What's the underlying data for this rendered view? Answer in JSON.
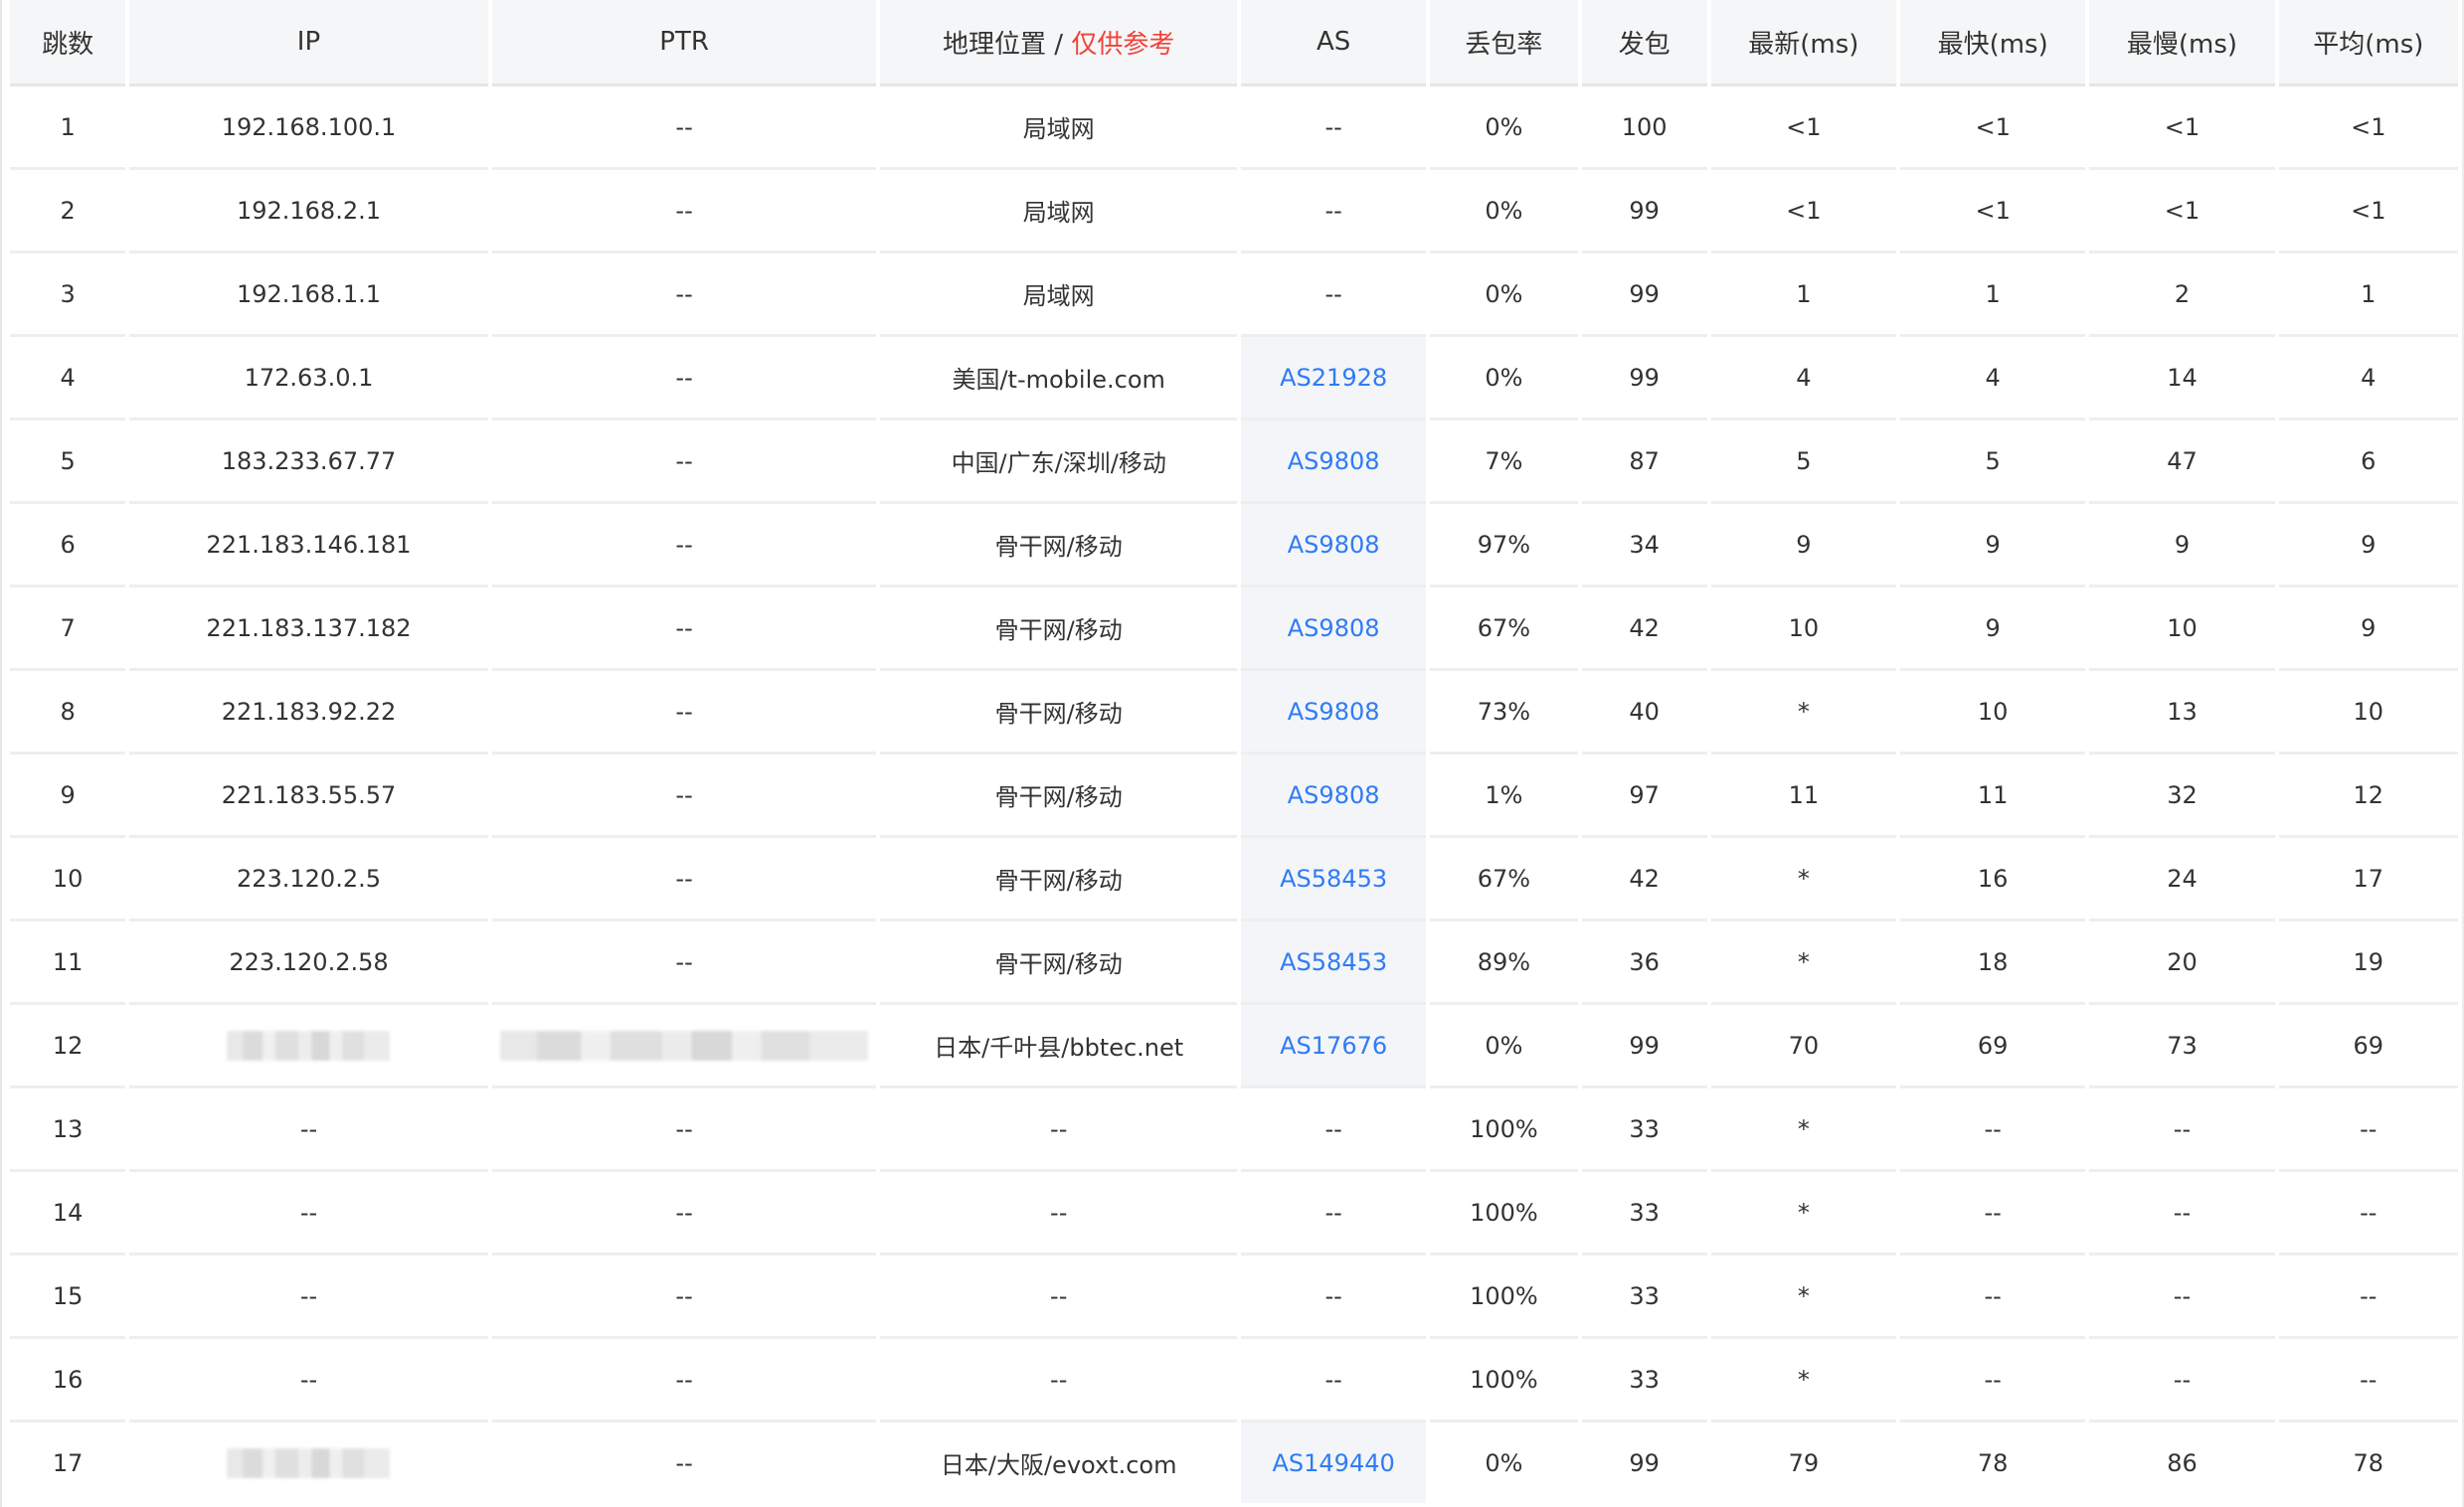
{
  "headers": {
    "hop": "跳数",
    "ip": "IP",
    "ptr": "PTR",
    "geo": "地理位置",
    "geo_sep": " / ",
    "geo_note": "仅供参考",
    "as": "AS",
    "loss": "丢包率",
    "sent": "发包",
    "last": "最新(ms)",
    "best": "最快(ms)",
    "worst": "最慢(ms)",
    "avg": "平均(ms)"
  },
  "colors": {
    "link": "#2f7bf5",
    "note": "#f0433a",
    "header_bg": "#f5f6f7",
    "as_cell_bg": "#f3f5f8"
  },
  "rows": [
    {
      "hop": "1",
      "ip": "192.168.100.1",
      "ip_redacted": false,
      "ptr": "--",
      "ptr_redacted": false,
      "geo": "局域网",
      "as": "--",
      "as_link": false,
      "loss": "0%",
      "sent": "100",
      "last": "<1",
      "best": "<1",
      "worst": "<1",
      "avg": "<1"
    },
    {
      "hop": "2",
      "ip": "192.168.2.1",
      "ip_redacted": false,
      "ptr": "--",
      "ptr_redacted": false,
      "geo": "局域网",
      "as": "--",
      "as_link": false,
      "loss": "0%",
      "sent": "99",
      "last": "<1",
      "best": "<1",
      "worst": "<1",
      "avg": "<1"
    },
    {
      "hop": "3",
      "ip": "192.168.1.1",
      "ip_redacted": false,
      "ptr": "--",
      "ptr_redacted": false,
      "geo": "局域网",
      "as": "--",
      "as_link": false,
      "loss": "0%",
      "sent": "99",
      "last": "1",
      "best": "1",
      "worst": "2",
      "avg": "1"
    },
    {
      "hop": "4",
      "ip": "172.63.0.1",
      "ip_redacted": false,
      "ptr": "--",
      "ptr_redacted": false,
      "geo": "美国/t-mobile.com",
      "as": "AS21928",
      "as_link": true,
      "loss": "0%",
      "sent": "99",
      "last": "4",
      "best": "4",
      "worst": "14",
      "avg": "4"
    },
    {
      "hop": "5",
      "ip": "183.233.67.77",
      "ip_redacted": false,
      "ptr": "--",
      "ptr_redacted": false,
      "geo": "中国/广东/深圳/移动",
      "as": "AS9808",
      "as_link": true,
      "loss": "7%",
      "sent": "87",
      "last": "5",
      "best": "5",
      "worst": "47",
      "avg": "6"
    },
    {
      "hop": "6",
      "ip": "221.183.146.181",
      "ip_redacted": false,
      "ptr": "--",
      "ptr_redacted": false,
      "geo": "骨干网/移动",
      "as": "AS9808",
      "as_link": true,
      "loss": "97%",
      "sent": "34",
      "last": "9",
      "best": "9",
      "worst": "9",
      "avg": "9"
    },
    {
      "hop": "7",
      "ip": "221.183.137.182",
      "ip_redacted": false,
      "ptr": "--",
      "ptr_redacted": false,
      "geo": "骨干网/移动",
      "as": "AS9808",
      "as_link": true,
      "loss": "67%",
      "sent": "42",
      "last": "10",
      "best": "9",
      "worst": "10",
      "avg": "9"
    },
    {
      "hop": "8",
      "ip": "221.183.92.22",
      "ip_redacted": false,
      "ptr": "--",
      "ptr_redacted": false,
      "geo": "骨干网/移动",
      "as": "AS9808",
      "as_link": true,
      "loss": "73%",
      "sent": "40",
      "last": "*",
      "best": "10",
      "worst": "13",
      "avg": "10"
    },
    {
      "hop": "9",
      "ip": "221.183.55.57",
      "ip_redacted": false,
      "ptr": "--",
      "ptr_redacted": false,
      "geo": "骨干网/移动",
      "as": "AS9808",
      "as_link": true,
      "loss": "1%",
      "sent": "97",
      "last": "11",
      "best": "11",
      "worst": "32",
      "avg": "12"
    },
    {
      "hop": "10",
      "ip": "223.120.2.5",
      "ip_redacted": false,
      "ptr": "--",
      "ptr_redacted": false,
      "geo": "骨干网/移动",
      "as": "AS58453",
      "as_link": true,
      "loss": "67%",
      "sent": "42",
      "last": "*",
      "best": "16",
      "worst": "24",
      "avg": "17"
    },
    {
      "hop": "11",
      "ip": "223.120.2.58",
      "ip_redacted": false,
      "ptr": "--",
      "ptr_redacted": false,
      "geo": "骨干网/移动",
      "as": "AS58453",
      "as_link": true,
      "loss": "89%",
      "sent": "36",
      "last": "*",
      "best": "18",
      "worst": "20",
      "avg": "19"
    },
    {
      "hop": "12",
      "ip": "",
      "ip_redacted": true,
      "ptr": "",
      "ptr_redacted": true,
      "geo": "日本/千叶县/bbtec.net",
      "as": "AS17676",
      "as_link": true,
      "loss": "0%",
      "sent": "99",
      "last": "70",
      "best": "69",
      "worst": "73",
      "avg": "69"
    },
    {
      "hop": "13",
      "ip": "--",
      "ip_redacted": false,
      "ptr": "--",
      "ptr_redacted": false,
      "geo": "--",
      "as": "--",
      "as_link": false,
      "loss": "100%",
      "sent": "33",
      "last": "*",
      "best": "--",
      "worst": "--",
      "avg": "--"
    },
    {
      "hop": "14",
      "ip": "--",
      "ip_redacted": false,
      "ptr": "--",
      "ptr_redacted": false,
      "geo": "--",
      "as": "--",
      "as_link": false,
      "loss": "100%",
      "sent": "33",
      "last": "*",
      "best": "--",
      "worst": "--",
      "avg": "--"
    },
    {
      "hop": "15",
      "ip": "--",
      "ip_redacted": false,
      "ptr": "--",
      "ptr_redacted": false,
      "geo": "--",
      "as": "--",
      "as_link": false,
      "loss": "100%",
      "sent": "33",
      "last": "*",
      "best": "--",
      "worst": "--",
      "avg": "--"
    },
    {
      "hop": "16",
      "ip": "--",
      "ip_redacted": false,
      "ptr": "--",
      "ptr_redacted": false,
      "geo": "--",
      "as": "--",
      "as_link": false,
      "loss": "100%",
      "sent": "33",
      "last": "*",
      "best": "--",
      "worst": "--",
      "avg": "--"
    },
    {
      "hop": "17",
      "ip": "",
      "ip_redacted": true,
      "ptr": "--",
      "ptr_redacted": false,
      "geo": "日本/大阪/evoxt.com",
      "as": "AS149440",
      "as_link": true,
      "loss": "0%",
      "sent": "99",
      "last": "79",
      "best": "78",
      "worst": "86",
      "avg": "78"
    }
  ]
}
